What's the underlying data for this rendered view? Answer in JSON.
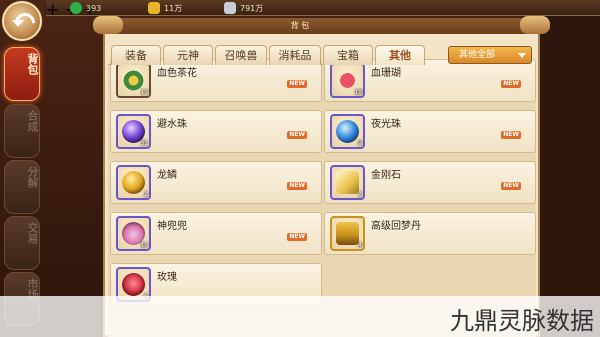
{
  "currency": [
    {
      "icon": "jade-icon",
      "value": "393",
      "color": "#2fae4a"
    },
    {
      "icon": "gold-ingot-icon",
      "value": "11万",
      "color": "#e9b32a"
    },
    {
      "icon": "silver-ingot-icon",
      "value": "791万",
      "color": "#c9cdd6"
    }
  ],
  "panel": {
    "title": "背 包"
  },
  "side_tabs": [
    {
      "label": "背包",
      "active": true
    },
    {
      "label": "合成",
      "active": false
    },
    {
      "label": "分解",
      "active": false
    },
    {
      "label": "交易",
      "active": false
    },
    {
      "label": "市场",
      "active": false
    }
  ],
  "tabs": [
    {
      "label": "装备",
      "active": false
    },
    {
      "label": "元神",
      "active": false
    },
    {
      "label": "召唤兽",
      "active": false
    },
    {
      "label": "消耗品",
      "active": false
    },
    {
      "label": "宝箱",
      "active": false
    },
    {
      "label": "其他",
      "active": true
    }
  ],
  "filter": {
    "label": "其他全部"
  },
  "items": [
    {
      "name": "血色茶花",
      "count": "13",
      "new": "NEW",
      "icon": "camellia-flower-icon",
      "color": "#3e8a3a",
      "frame": "plain"
    },
    {
      "name": "血珊瑚",
      "count": "18",
      "new": "NEW",
      "icon": "red-coral-icon",
      "color": "#e8506a",
      "frame": "rare"
    },
    {
      "name": "避水珠",
      "count": "31",
      "new": "NEW",
      "icon": "purple-orb-icon",
      "color": "#7a4ad8",
      "frame": "rare"
    },
    {
      "name": "夜光珠",
      "count": "9",
      "new": "NEW",
      "icon": "blue-orb-icon",
      "color": "#3a8ee0",
      "frame": "rare"
    },
    {
      "name": "龙鳞",
      "count": "2",
      "new": "NEW",
      "icon": "dragon-scale-icon",
      "color": "#e0a41c",
      "frame": "rare"
    },
    {
      "name": "金刚石",
      "count": "2",
      "new": "NEW",
      "icon": "diamond-stone-icon",
      "color": "#e8c24a",
      "frame": "rare"
    },
    {
      "name": "神兜兜",
      "count": "15",
      "new": "NEW",
      "icon": "pouch-icon",
      "color": "#d87ab0",
      "frame": "rare"
    },
    {
      "name": "高级回梦丹",
      "count": "4",
      "new": "",
      "icon": "treasure-chest-icon",
      "color": "#c8921c",
      "frame": "gold"
    },
    {
      "name": "玫瑰",
      "count": "6",
      "new": "",
      "icon": "rose-icon",
      "color": "#d83a4a",
      "frame": "rare"
    }
  ],
  "watermark": "九鼎灵脉数据"
}
